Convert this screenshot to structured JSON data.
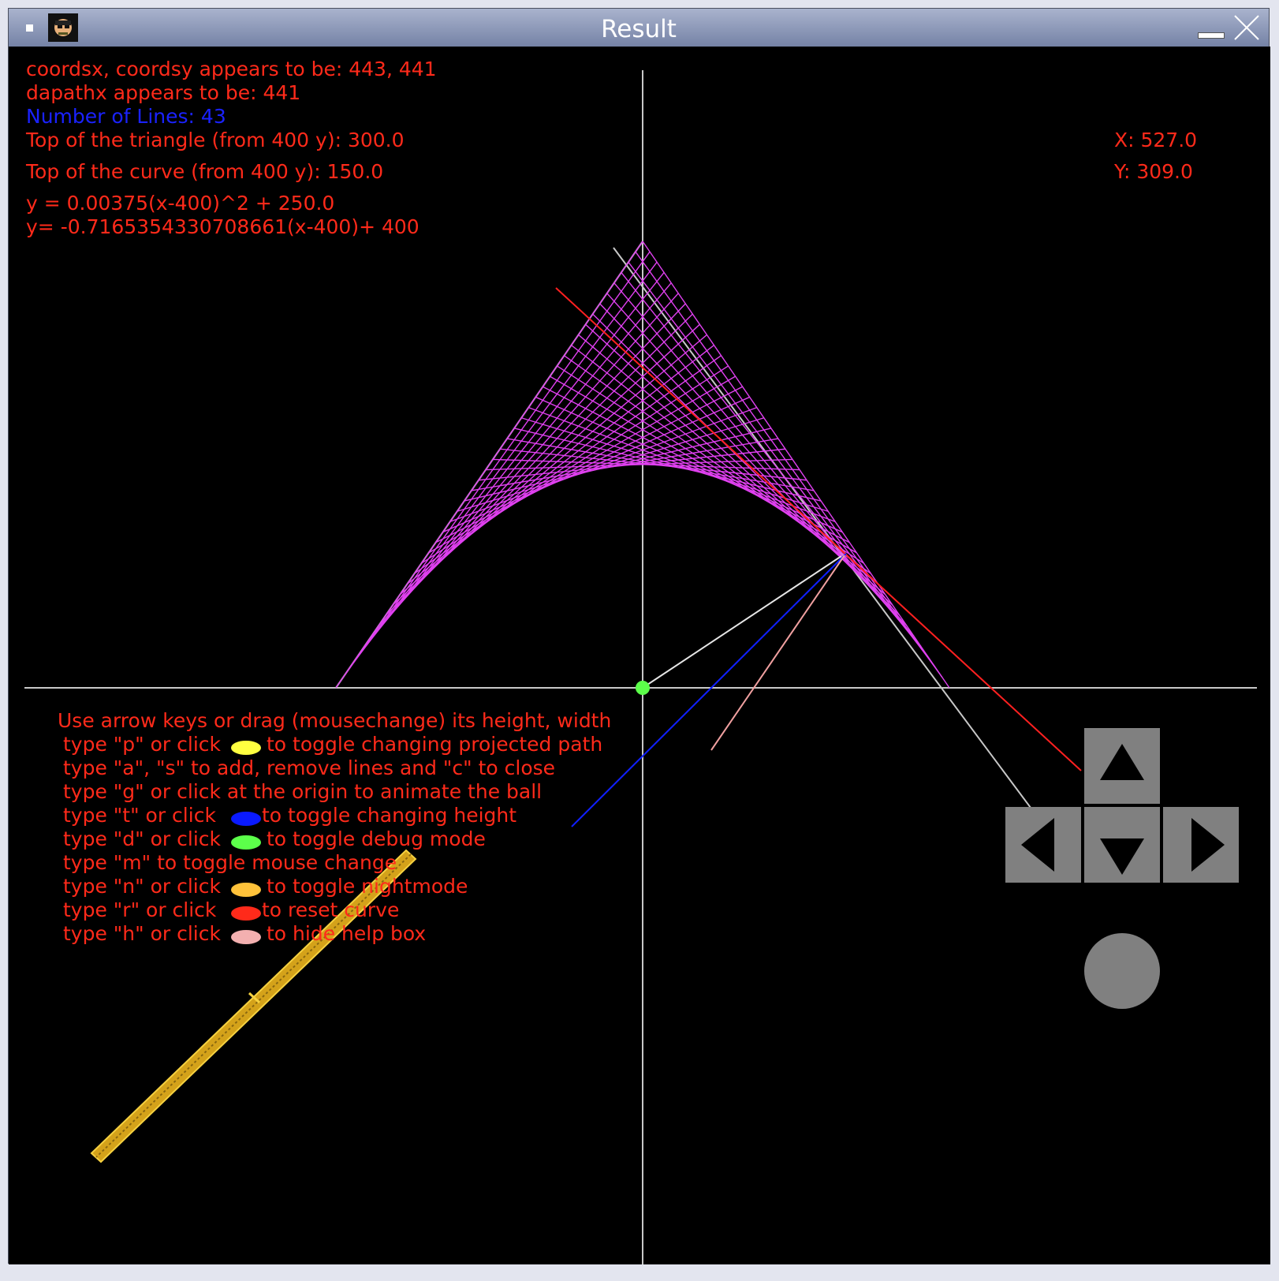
{
  "window": {
    "title": "Result"
  },
  "info": {
    "coords": "coordsx, coordsy appears to be: 443, 441",
    "dapath": "dapathx appears to be: 441",
    "lines": "Number of Lines: 43",
    "triangle_top": "Top of the triangle (from 400 y): 300.0",
    "curve_top": "Top of the curve (from 400 y): 150.0",
    "parabola_eq": "y = 0.00375(x-400)^2 + 250.0",
    "tangent_eq": "y= -0.7165354330708661(x-400)+ 400",
    "mouse_x": "X: 527.0",
    "mouse_y": "Y: 309.0"
  },
  "help": {
    "intro": "Use arrow keys or drag (mousechange) its height, width",
    "items": [
      {
        "prefix": "type \"p\" or click",
        "suffix": "to toggle changing projected path",
        "color": "#ffff40"
      },
      {
        "text": "type \"a\", \"s\" to add, remove lines and \"c\" to close"
      },
      {
        "text": "type \"g\" or click at the origin to animate the ball"
      },
      {
        "prefix": "type \"t\" or click",
        "suffix": "to toggle changing height",
        "color": "#0a1aff"
      },
      {
        "prefix": "type \"d\" or click",
        "suffix": "to toggle debug mode",
        "color": "#5cff4a"
      },
      {
        "text": "type \"m\" to toggle mouse change"
      },
      {
        "prefix": "type \"n\" or click",
        "suffix": "to toggle nightmode",
        "color": "#ffc23a"
      },
      {
        "prefix": "type \"r\" or click",
        "suffix": "to reset curve",
        "color": "#ff2a1a"
      },
      {
        "prefix": "type \"h\" or click",
        "suffix": "to hide help box",
        "color": "#f3b0b0"
      }
    ]
  },
  "colors": {
    "text": "#ff2a1a",
    "lines_count": "#1a22ff",
    "axis": "#c8c8c8",
    "string_art": "#e040f0",
    "tangent": "#ff2020",
    "ball": "#5cff4a",
    "control": "#808080"
  },
  "controls": {
    "up": "arrow-up",
    "down": "arrow-down",
    "left": "arrow-left",
    "right": "arrow-right",
    "action": "circle-button"
  }
}
